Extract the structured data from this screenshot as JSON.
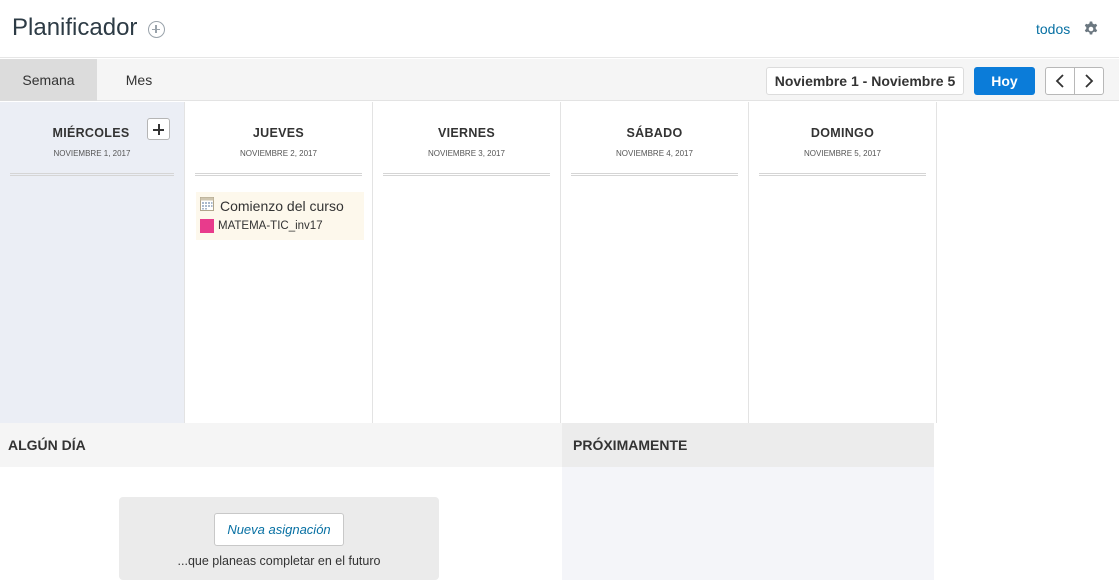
{
  "header": {
    "title": "Planificador",
    "todos_link": "todos"
  },
  "toolbar": {
    "tabs": [
      {
        "label": "Semana",
        "active": true
      },
      {
        "label": "Mes",
        "active": false
      }
    ],
    "range": "Noviembre 1 - Noviembre 5",
    "today_label": "Hoy"
  },
  "days": [
    {
      "name": "MIÉRCOLES",
      "date": "NOVIEMBRE 1, 2017",
      "today": true
    },
    {
      "name": "JUEVES",
      "date": "NOVIEMBRE 2, 2017"
    },
    {
      "name": "VIERNES",
      "date": "NOVIEMBRE 3, 2017"
    },
    {
      "name": "SÁBADO",
      "date": "NOVIEMBRE 4, 2017"
    },
    {
      "name": "DOMINGO",
      "date": "NOVIEMBRE 5, 2017"
    }
  ],
  "event": {
    "title": "Comienzo del curso",
    "course": "MATEMA-TIC_inv17",
    "course_color": "#e83b8c"
  },
  "someday": {
    "title": "ALGÚN DÍA",
    "button_label": "Nueva asignación",
    "hint": "...que planeas completar en el futuro"
  },
  "upcoming": {
    "title": "PRÓXIMAMENTE"
  },
  "colors": {
    "accent": "#0b7cd9",
    "link": "#0770a3",
    "today_column": "#ebeef5"
  }
}
